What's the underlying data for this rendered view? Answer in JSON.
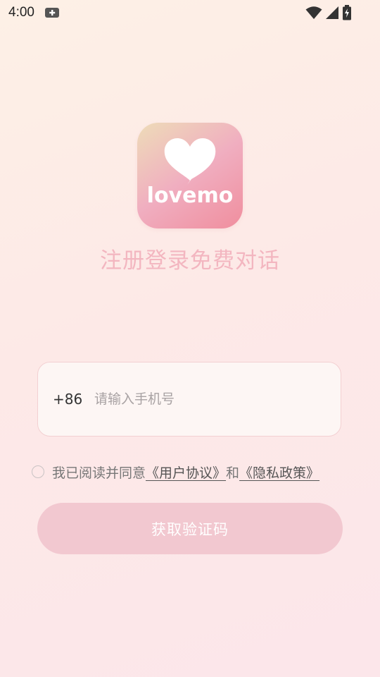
{
  "status_bar": {
    "time": "4:00",
    "icons": [
      "notification-icon",
      "wifi-icon",
      "cellular-icon",
      "battery-charging-icon"
    ]
  },
  "logo": {
    "text": "lovemo",
    "icon": "heart-icon"
  },
  "tagline": "注册登录免费对话",
  "phone": {
    "country_code": "+86",
    "value": "",
    "placeholder": "请输入手机号"
  },
  "agreement": {
    "checked": false,
    "text": "我已阅读并同意",
    "user_agreement": "《用户协议》",
    "and": "和",
    "privacy_policy": "《隐私政策》"
  },
  "get_code_button": "获取验证码",
  "colors": {
    "tagline": "#f3b6c0",
    "button": "#f2c8d0",
    "input_border": "#f3d0d2"
  }
}
